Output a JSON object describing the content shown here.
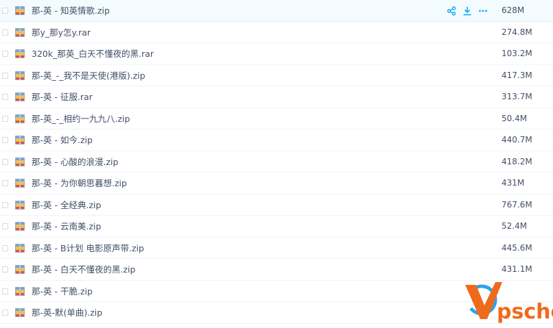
{
  "files": [
    {
      "name": "那-英 - 知英情歌.zip",
      "size": "628M",
      "selected": true
    },
    {
      "name": "那y_那y怎y.rar",
      "size": "274.8M"
    },
    {
      "name": "320k_那英_白天不懂夜的黑.rar",
      "size": "103.2M"
    },
    {
      "name": "那-英_-_我不是天使(港版).zip",
      "size": "417.3M"
    },
    {
      "name": "那-英 - 征服.rar",
      "size": "313.7M"
    },
    {
      "name": "那-英_-_相约一九九八.zip",
      "size": "50.4M"
    },
    {
      "name": "那-英 - 如今.zip",
      "size": "440.7M"
    },
    {
      "name": "那-英 - 心酸的浪漫.zip",
      "size": "418.2M"
    },
    {
      "name": "那-英 - 为你朝思暮想.zip",
      "size": "431M"
    },
    {
      "name": "那-英 - 全经典.zip",
      "size": "767.6M"
    },
    {
      "name": "那-英 - 云南美.zip",
      "size": "52.4M"
    },
    {
      "name": "那-英 - B计划 电影原声带.zip",
      "size": "445.6M"
    },
    {
      "name": "那-英 - 白天不懂夜的黑.zip",
      "size": "431.1M"
    },
    {
      "name": "那-英 - 干脆.zip",
      "size": ""
    },
    {
      "name": "那-英-默(单曲).zip",
      "size": ""
    }
  ],
  "row_actions": [
    "share-icon",
    "download-icon",
    "more-icon"
  ],
  "watermark": {
    "text": "psche",
    "logo_letter": "V"
  },
  "colors": {
    "accent": "#06a7ff",
    "text": "#424e67",
    "selected_bg": "#f4fbff",
    "watermark_orange": "#f06a1c"
  }
}
